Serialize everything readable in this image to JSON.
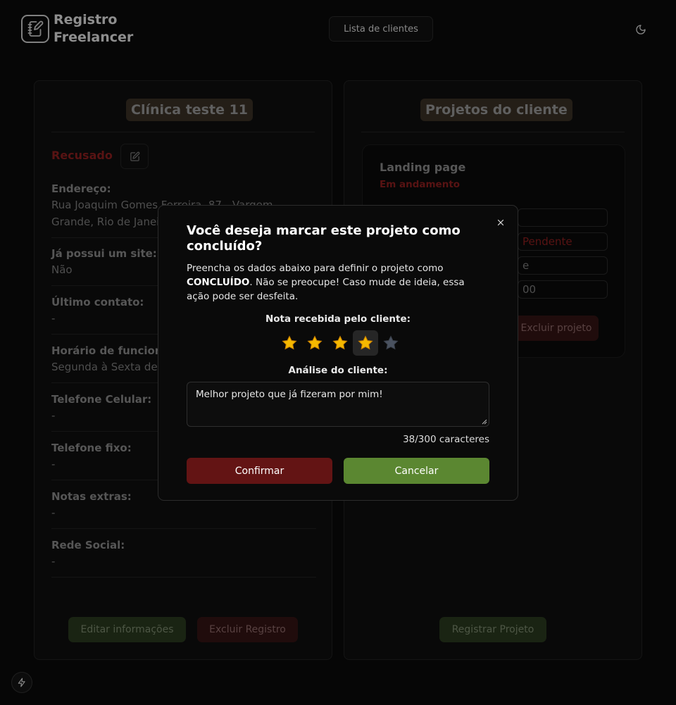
{
  "app": {
    "title": "Registro Freelancer",
    "title_line1": "Registro",
    "title_line2": "Freelancer"
  },
  "nav": {
    "clients_list": "Lista de clientes"
  },
  "client": {
    "name": "Clínica teste 11",
    "status": "Recusado",
    "fields": [
      {
        "label": "Endereço:",
        "value_line1": "Rua Joaquim Gomes Ferreira, 87 - Vargem",
        "value_line2": "Grande, Rio de Janeiro"
      },
      {
        "label": "Já possui um site:",
        "value": "Não"
      },
      {
        "label": "Último contato:",
        "value": "-"
      },
      {
        "label": "Horário de funcionamento:",
        "value": "Segunda à Sexta de"
      },
      {
        "label": "Telefone Celular:",
        "value": "-"
      },
      {
        "label": "Telefone fixo:",
        "value": "-"
      },
      {
        "label": "Notas extras:",
        "value": "-"
      },
      {
        "label": "Rede Social:",
        "value": "-"
      }
    ],
    "edit_button": "Editar informações",
    "delete_button": "Excluir Registro"
  },
  "projects": {
    "title": "Projetos do cliente",
    "items": [
      {
        "name": "Landing page",
        "status": "Em andamento",
        "payment_status": "Pendente",
        "field3_tail": "e",
        "field4_tail": "00",
        "delete_button": "Excluir projeto"
      }
    ],
    "register_button": "Registrar Projeto"
  },
  "modal": {
    "title": "Você deseja marcar este projeto como concluído?",
    "desc_part1": "Preencha os dados abaixo para definir o projeto como ",
    "desc_bold": "CONCLUÍDO",
    "desc_part2": ". Não se preocupe! Caso mude de ideia, essa ação pode ser desfeita.",
    "rating_label": "Nota recebida pelo cliente:",
    "rating": 4,
    "rating_max": 5,
    "analysis_label": "Análise do cliente:",
    "analysis_value": "Melhor projeto que já fizeram por mim!",
    "counter": "38/300 caracteres",
    "confirm": "Confirmar",
    "cancel": "Cancelar"
  },
  "colors": {
    "confirm": "#631414",
    "cancel": "#5b8731",
    "star_filled": "#f5b800",
    "star_empty": "#4a5260",
    "status_red": "#8e1f1f"
  }
}
